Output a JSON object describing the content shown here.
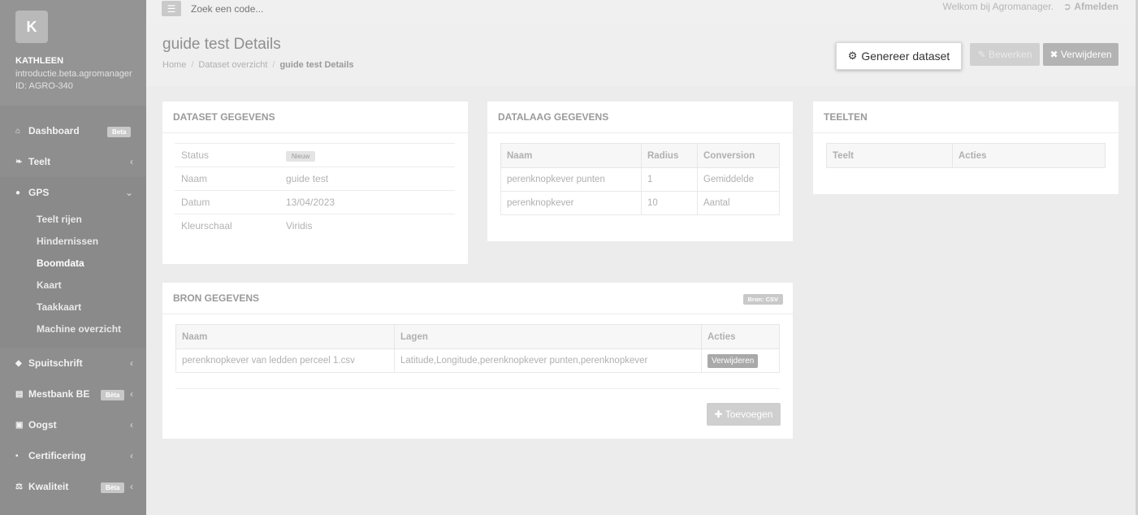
{
  "topbar": {
    "search_placeholder": "Zoek een code...",
    "welcome": "Welkom bij Agromanager.",
    "logout": "Afmelden"
  },
  "profile": {
    "initial": "K",
    "name": "KATHLEEN",
    "line1": "introductie.beta.agromanager",
    "line2": "ID: AGRO-340"
  },
  "sidebar": {
    "dashboard": "Dashboard",
    "dashboard_badge": "Beta",
    "teelt": "Teelt",
    "gps": "GPS",
    "gps_sub": [
      "Teelt rijen",
      "Hindernissen",
      "Boomdata",
      "Kaart",
      "Taakkaart",
      "Machine overzicht"
    ],
    "spuitschrift": "Spuitschrift",
    "mestbank": "Mestbank BE",
    "mestbank_badge": "Bèta",
    "oogst": "Oogst",
    "certificering": "Certificering",
    "kwaliteit": "Kwaliteit",
    "kwaliteit_badge": "Bèta"
  },
  "header": {
    "title": "guide test Details",
    "breadcrumb": {
      "home": "Home",
      "overview": "Dataset overzicht",
      "current": "guide test Details"
    },
    "generate": "Genereer dataset",
    "edit": "Bewerken",
    "delete": "Verwijderen"
  },
  "dataset": {
    "title": "DATASET GEGEVENS",
    "status_label": "Status",
    "status_value": "Nieuw",
    "name_label": "Naam",
    "name_value": "guide test",
    "date_label": "Datum",
    "date_value": "13/04/2023",
    "scale_label": "Kleurschaal",
    "scale_value": "Viridis"
  },
  "datalaag": {
    "title": "DATALAAG GEGEVENS",
    "columns": [
      "Naam",
      "Radius",
      "Conversion"
    ],
    "rows": [
      [
        "perenknopkever punten",
        "1",
        "Gemiddelde"
      ],
      [
        "perenknopkever",
        "10",
        "Aantal"
      ]
    ]
  },
  "teelten": {
    "title": "TEELTEN",
    "columns": [
      "Teelt",
      "Acties"
    ]
  },
  "bron": {
    "title": "BRON GEGEVENS",
    "badge": "Bron: CSV",
    "columns": [
      "Naam",
      "Lagen",
      "Acties"
    ],
    "rows": [
      [
        "perenknopkever van ledden perceel 1.csv",
        "Latitude,Longitude,perenknopkever punten,perenknopkever",
        "Verwijderen"
      ]
    ],
    "add": "Toevoegen"
  }
}
